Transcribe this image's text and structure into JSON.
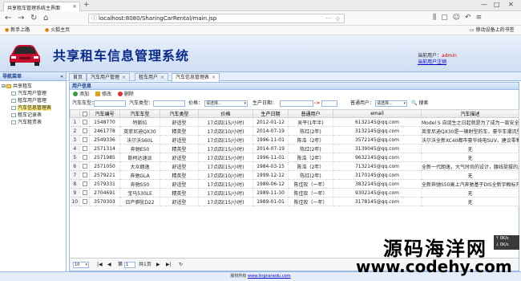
{
  "browser": {
    "tab_title": "共享租车管理系统主界面",
    "url": "localhost:8080/SharingCarRental/main.jsp",
    "url_more": "···",
    "bookmarks": [
      "新手上路",
      "火狐主页"
    ],
    "mobile_bookmarks": "移动设备上的书签"
  },
  "app": {
    "title": "共享租车信息管理系统",
    "user_prefix": "当前用户：",
    "user_name": "admin",
    "logout": "当前用户注销"
  },
  "sidebar": {
    "title": "导航菜单",
    "root": "共享租车",
    "items": [
      "汽车用户管理",
      "租车用户管理",
      "汽车信息管理表",
      "租车记录表",
      "汽车租赁表"
    ],
    "selected_index": 2
  },
  "tabs": [
    {
      "label": "首页",
      "closable": false
    },
    {
      "label": "汽车用户管理",
      "closable": true
    },
    {
      "label": "租车用户",
      "closable": true
    },
    {
      "label": "汽车信息管理表",
      "closable": true
    }
  ],
  "active_tab": 3,
  "grid": {
    "title": "用户信息",
    "toolbar": {
      "add": "添加",
      "edit": "修改",
      "delete": "删除"
    },
    "search": {
      "car_no_label": "汽车车型：",
      "car_type_label": "汽车类型：",
      "price_label": "价格：",
      "price_select": "请选择...",
      "date_label": "生产日期：",
      "date_sep": "->",
      "user_label": "普通用户：",
      "user_select": "请选择...",
      "search_btn": "搜索"
    },
    "columns": [
      "汽车编号",
      "汽车车型",
      "汽车类型",
      "价格",
      "生产日期",
      "普通用户",
      "email",
      "汽车描述"
    ],
    "rows": [
      [
        "1",
        "1548770",
        "特斯拉",
        "舒适型",
        "17点四(15/小时)",
        "2012-01-12",
        "吴平(1年半)",
        "6132145@qq.com",
        "Model S 自诞生之日起就是为了成为一款安全、高性能"
      ],
      [
        "2",
        "2461778",
        "英菲尼迪QX30",
        "精英型",
        "17点四(10/小时)",
        "2014-07-19",
        "陈红(2年)",
        "3132145@qq.com",
        "英菲尼迪QX30是一辆射型的车，豪华车潮流型SUV。"
      ],
      [
        "3",
        "2549336",
        "沃尔沃S60L",
        "舒适型",
        "17点四(15/小时)",
        "1996-11-01",
        "陈浩（2年）",
        "3572145@qq.com",
        "沃尔沃全新XC40都市豪华纯电SUV，建议零售价26.48"
      ],
      [
        "4",
        "2571314",
        "奔驰E50",
        "精英型",
        "17点四(15/小时)",
        "2014-07-19",
        "陈红(2年)",
        "3139045@qq.com",
        "无"
      ],
      [
        "5",
        "2571985",
        "斯柯达速派",
        "舒适型",
        "17点四(15/小时)",
        "1996-11-01",
        "陈浩（2年）",
        "9632145@qq.com",
        "无"
      ],
      [
        "6",
        "2571050",
        "大众朗逸",
        "舒适型",
        "17点四(15/小时)",
        "1984-03-15",
        "陈浩（2年）",
        "7132145@qq.com",
        "全新一代朗逸，大气时尚的设计，腰线挺拔的尺寸，以"
      ],
      [
        "7",
        "2579221",
        "奔驰GLA",
        "精英型",
        "17点四(10/小时)",
        "1999-12-12",
        "陈红(2年)",
        "3170145@qq.com",
        "无"
      ],
      [
        "8",
        "2579331",
        "奔驰S50",
        "舒适型",
        "17点四(15/小时)",
        "1989-06-12",
        "陈佳玫（一年）",
        "3832145@qq.com",
        "全新奔驰S50高上汽奔驰基于DIS全新宇概标开发系统"
      ],
      [
        "9",
        "2704691",
        "宝马530LE",
        "精英型",
        "17点四(15/小时)",
        "1989-11-30",
        "陈佳玫（一年）",
        "9302145@qq.com",
        "无"
      ],
      [
        "10",
        "3570303",
        "日产骐犹D22",
        "舒适型",
        "17点四(15/小时)",
        "1989-01-01",
        "陈佳玫（一年）",
        "3178145@qq.com",
        "无"
      ]
    ],
    "pager": {
      "page_size": "10",
      "page_label": "第",
      "page": "1",
      "total": "共1页"
    }
  },
  "footer": {
    "text": "版权所有 ",
    "link": "www.lingnanedu.com"
  },
  "watermark": {
    "cn": "源码海洋网",
    "url": "www.codehy.com"
  },
  "netspeed": {
    "up": "↑ 0K/s",
    "down": "↓ 0K/s"
  }
}
